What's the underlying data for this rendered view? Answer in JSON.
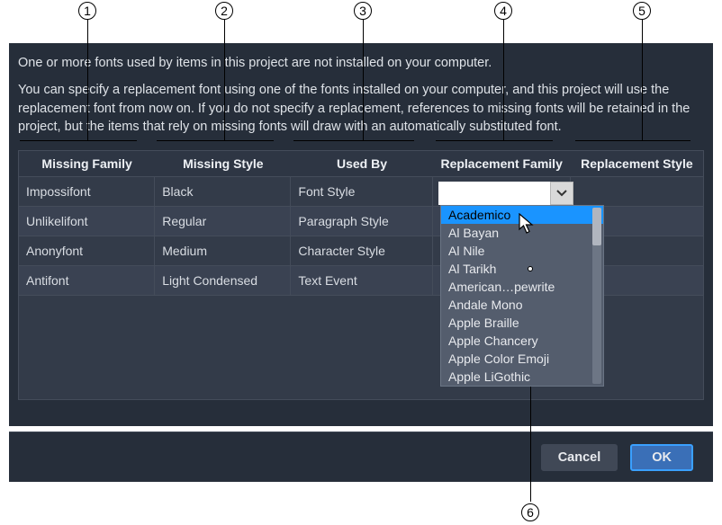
{
  "callouts": {
    "c1": "1",
    "c2": "2",
    "c3": "3",
    "c4": "4",
    "c5": "5",
    "c6": "6"
  },
  "paragraph1": "One or more fonts used by items in this project are not installed on your computer.",
  "paragraph2": "You can specify a replacement font using one of the fonts installed on your computer, and this project will use the replacement font from now on. If you do not specify a replacement, references to missing fonts will be retained in the project, but the items that rely on missing fonts will draw with an automatically substituted font.",
  "headers": {
    "missing_family": "Missing Family",
    "missing_style": "Missing Style",
    "used_by": "Used By",
    "replacement_family": "Replacement Family",
    "replacement_style": "Replacement Style"
  },
  "rows": [
    {
      "family": "Impossifont",
      "style": "Black",
      "used": "Font Style",
      "rep_family": "",
      "rep_style": ""
    },
    {
      "family": "Unlikelifont",
      "style": "Regular",
      "used": "Paragraph Style",
      "rep_family": "",
      "rep_style": ""
    },
    {
      "family": "Anonyfont",
      "style": "Medium",
      "used": "Character Style",
      "rep_family": "",
      "rep_style": ""
    },
    {
      "family": "Antifont",
      "style": "Light Condensed",
      "used": "Text Event",
      "rep_family": "",
      "rep_style": ""
    }
  ],
  "dropdown": {
    "items": [
      "Academico",
      "Al Bayan",
      "Al Nile",
      "Al Tarikh",
      "American…pewrite",
      "Andale Mono",
      "Apple Braille",
      "Apple Chancery",
      "Apple Color Emoji",
      "Apple LiGothic"
    ],
    "selected_index": 0
  },
  "buttons": {
    "cancel": "Cancel",
    "ok": "OK"
  }
}
